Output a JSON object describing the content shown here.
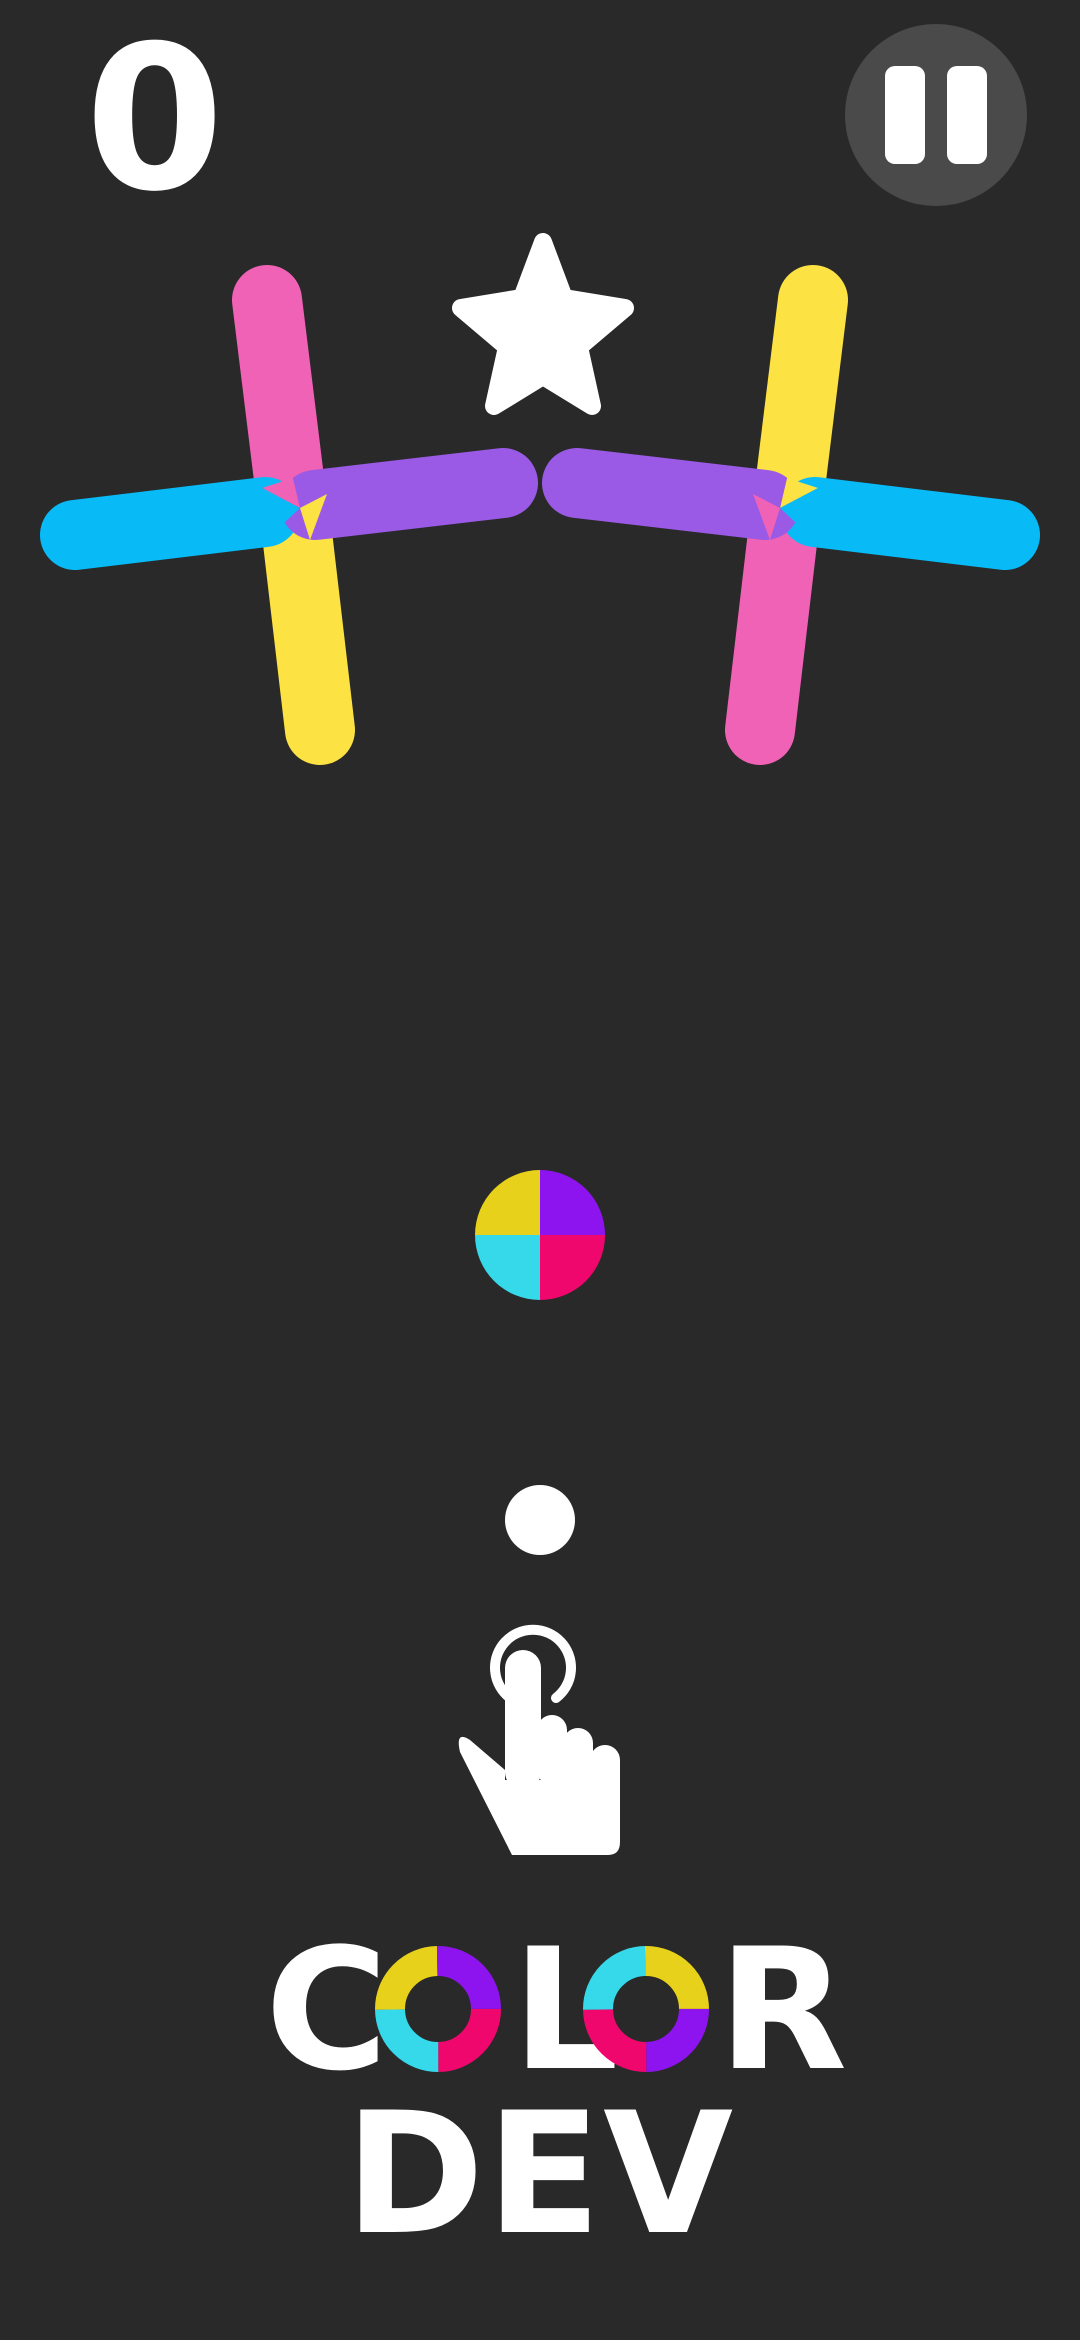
{
  "hud": {
    "score": "0",
    "pause_icon": "pause-icon"
  },
  "colors": {
    "background": "#292929",
    "pink": "#F062B6",
    "purple": "#9A5AE6",
    "cyan": "#08BBF6",
    "yellow": "#FDE243",
    "ball_yellow": "#E8D11A",
    "ball_purple": "#8E14EF",
    "ball_cyan": "#35D9EA",
    "ball_magenta": "#F0076E",
    "white": "#FFFFFF"
  },
  "game": {
    "obstacle": "double-cross-obstacle",
    "star_icon": "star-icon",
    "color_switcher_icon": "color-switcher-ball",
    "player_ball": "player-ball",
    "tap_hint_icon": "tap-hand-icon"
  },
  "title": {
    "line1_start": "C",
    "line1_end_l": "L",
    "line1_end_r": "R",
    "line2": "DEV"
  }
}
